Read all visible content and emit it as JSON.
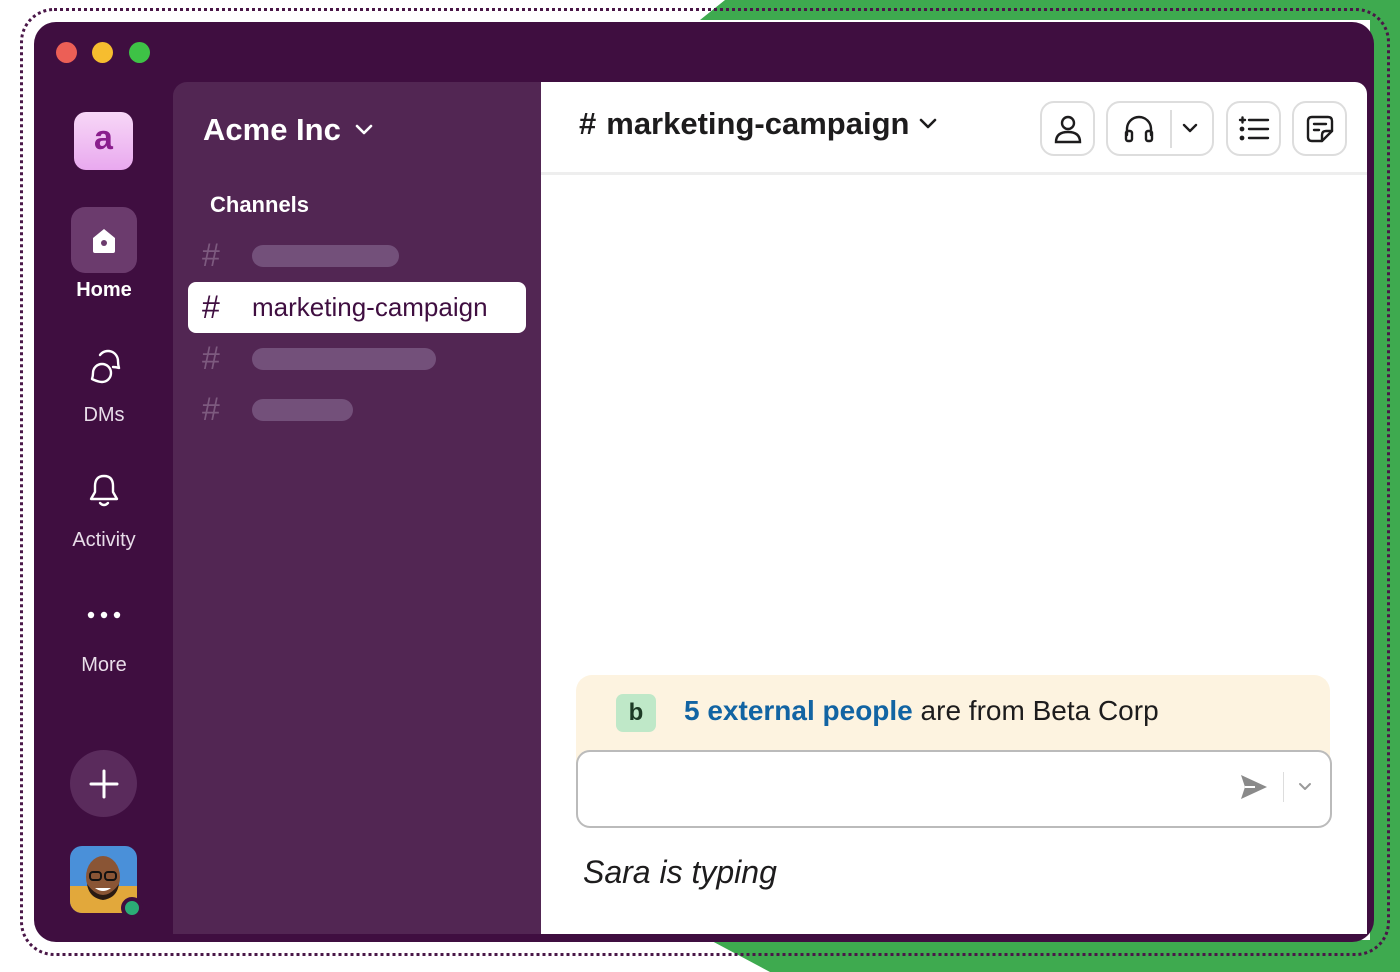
{
  "colors": {
    "window_bg": "#3f0e40",
    "sidebar_bg": "#522653",
    "accent_green": "#3eaa4f",
    "link_blue": "#1264a3",
    "banner_bg": "#fdf3e0",
    "presence_green": "#2bac76"
  },
  "window_controls": [
    "close",
    "minimize",
    "maximize"
  ],
  "rail": {
    "workspace_initial": "a",
    "items": [
      {
        "label": "Home",
        "icon": "home-icon",
        "active": true
      },
      {
        "label": "DMs",
        "icon": "dms-icon",
        "active": false
      },
      {
        "label": "Activity",
        "icon": "bell-icon",
        "active": false
      },
      {
        "label": "More",
        "icon": "more-icon",
        "active": false
      }
    ],
    "add_icon": "plus-icon",
    "avatar_status": "online"
  },
  "sidebar": {
    "workspace_name": "Acme Inc",
    "section_title": "Channels",
    "channels": [
      {
        "hash": "#",
        "label": "",
        "placeholder": true
      },
      {
        "hash": "#",
        "label": "marketing-campaign",
        "active": true
      },
      {
        "hash": "#",
        "label": "",
        "placeholder": true
      },
      {
        "hash": "#",
        "label": "",
        "placeholder": true
      }
    ]
  },
  "header": {
    "hash": "#",
    "channel_name": "marketing-campaign",
    "buttons": [
      "members-icon",
      "headphones-icon",
      "chevron-down-icon",
      "list-icon",
      "canvas-icon"
    ]
  },
  "banner": {
    "badge": "b",
    "link_text": "5 external people",
    "rest_text": " are from Beta Corp"
  },
  "composer": {
    "value": "",
    "send_icon": "send-icon",
    "options_icon": "chevron-down-icon"
  },
  "typing": {
    "name": "Sara",
    "text": " is typing"
  }
}
